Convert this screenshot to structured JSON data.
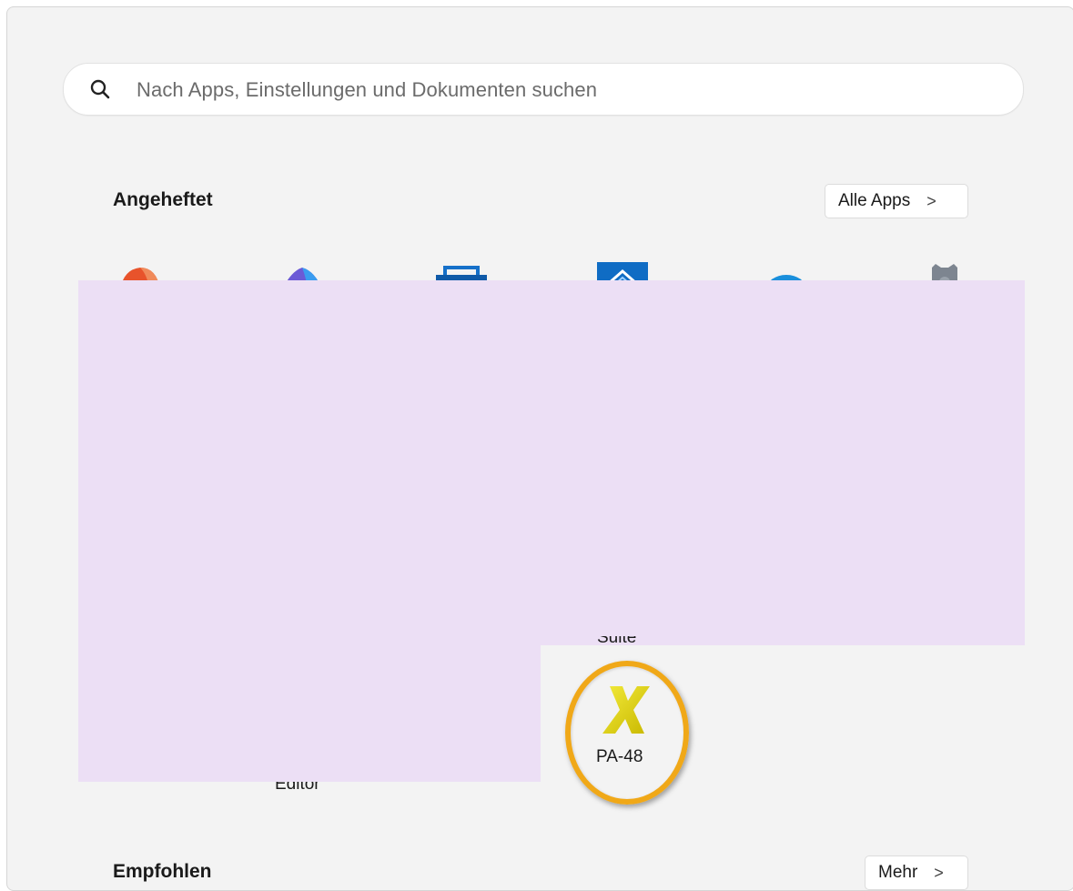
{
  "search": {
    "placeholder": "Nach Apps, Einstellungen und Dokumenten suchen"
  },
  "pinned": {
    "title": "Angeheftet",
    "all_apps_label": "Alle Apps",
    "all_apps_chevron": ">"
  },
  "tiles": {
    "partial_label_suite": "Suite",
    "partial_label_editor": "Editor",
    "pa48_label": "PA-48"
  },
  "recommended": {
    "title": "Empfohlen",
    "more_label": "Mehr",
    "more_chevron": ">"
  },
  "colors": {
    "highlight": "#f0a818",
    "redaction": "#ecdff5",
    "pa48_icon": "#e2d600"
  }
}
